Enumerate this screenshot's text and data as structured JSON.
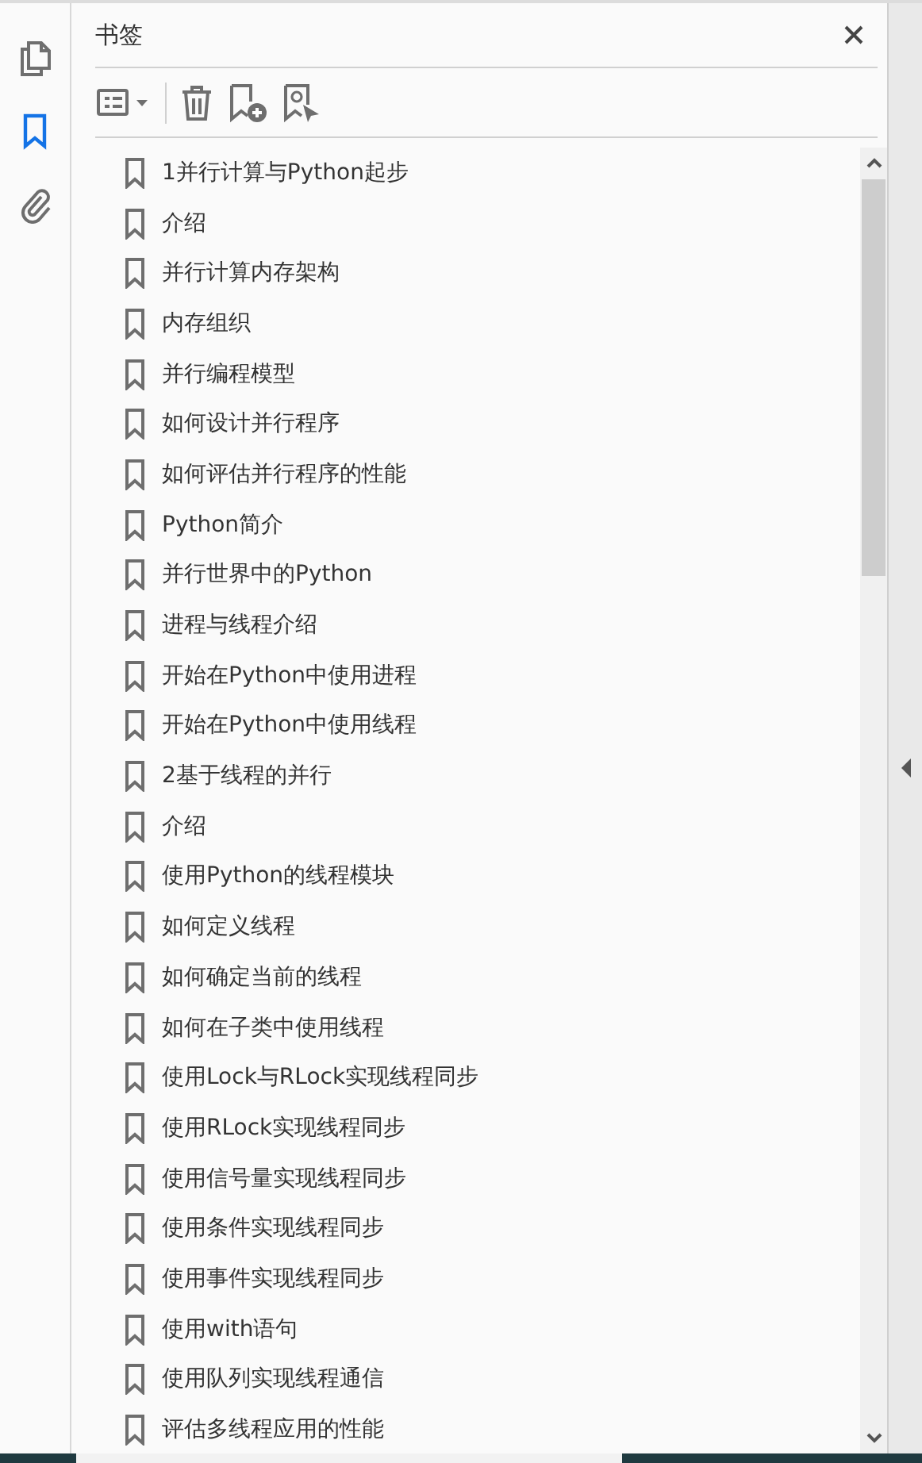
{
  "rail": [
    {
      "kind": "pages",
      "selected": false
    },
    {
      "kind": "bookmarks",
      "selected": true
    },
    {
      "kind": "attachments",
      "selected": false
    }
  ],
  "panel": {
    "title": "书签"
  },
  "bookmarks": [
    {
      "label": "1并行计算与Python起步"
    },
    {
      "label": "介绍"
    },
    {
      "label": "并行计算内存架构"
    },
    {
      "label": "内存组织"
    },
    {
      "label": "并行编程模型"
    },
    {
      "label": "如何设计并行程序"
    },
    {
      "label": "如何评估并行程序的性能"
    },
    {
      "label": "Python简介"
    },
    {
      "label": "并行世界中的Python"
    },
    {
      "label": "进程与线程介绍"
    },
    {
      "label": "开始在Python中使用进程"
    },
    {
      "label": "开始在Python中使用线程"
    },
    {
      "label": "2基于线程的并行"
    },
    {
      "label": "介绍"
    },
    {
      "label": "使用Python的线程模块"
    },
    {
      "label": "如何定义线程"
    },
    {
      "label": "如何确定当前的线程"
    },
    {
      "label": "如何在子类中使用线程"
    },
    {
      "label": "使用Lock与RLock实现线程同步"
    },
    {
      "label": "使用RLock实现线程同步"
    },
    {
      "label": "使用信号量实现线程同步"
    },
    {
      "label": "使用条件实现线程同步"
    },
    {
      "label": "使用事件实现线程同步"
    },
    {
      "label": "使用with语句"
    },
    {
      "label": "使用队列实现线程通信"
    },
    {
      "label": "评估多线程应用的性能"
    }
  ]
}
